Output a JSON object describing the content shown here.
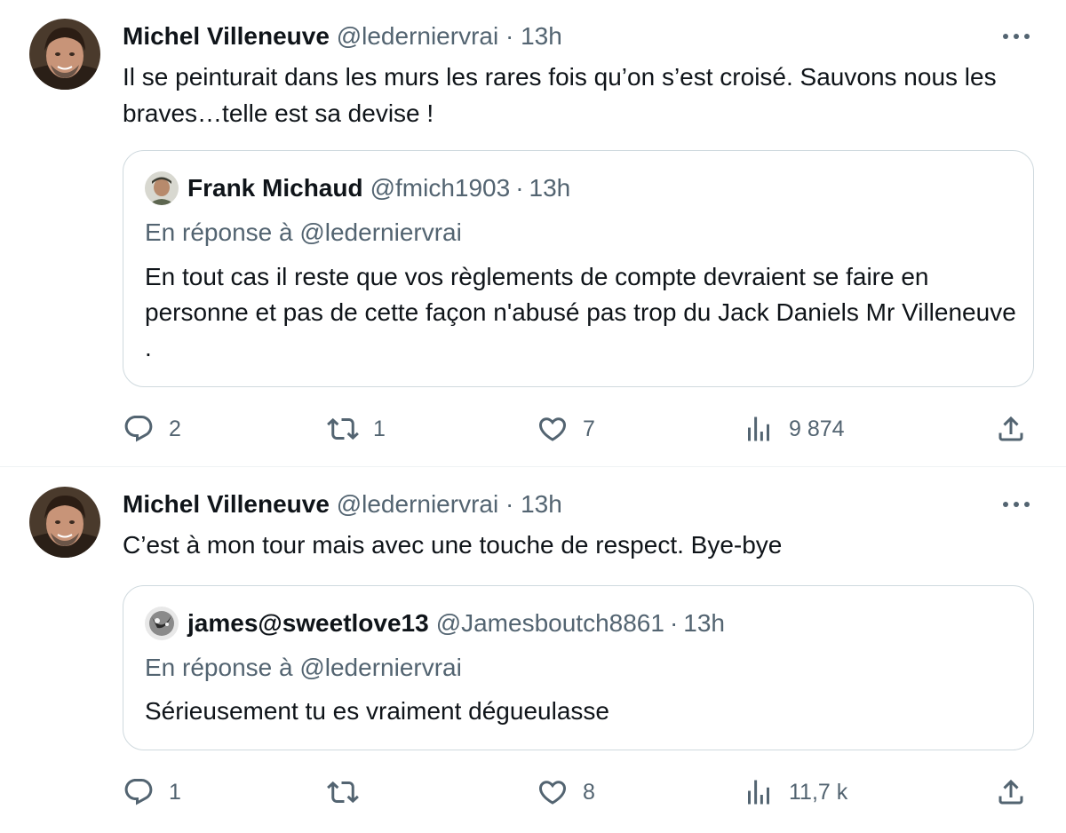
{
  "tweets": [
    {
      "author_name": "Michel Villeneuve",
      "author_handle": "@ledernierv​rai",
      "separator": "·",
      "time": "13h",
      "text": "Il se peinturait dans les murs les rares fois qu’on s’est croisé.  Sauvons nous les braves…telle est sa devise !",
      "quote": {
        "author_name": "Frank Michaud",
        "author_handle": "@fmich1903",
        "separator": "·",
        "time": "13h",
        "reply_to": "En réponse à @ledernierv​rai",
        "text": "En tout cas il reste que vos règlements de compte devraient se faire en personne et pas de cette façon n'abusé pas trop du Jack Daniels Mr Villeneuve ."
      },
      "actions": {
        "replies": "2",
        "retweets": "1",
        "likes": "7",
        "views": "9 874"
      }
    },
    {
      "author_name": "Michel Villeneuve",
      "author_handle": "@ledernierv​rai",
      "separator": "·",
      "time": "13h",
      "text": "C’est à mon tour mais avec une touche de respect.  Bye-bye",
      "quote": {
        "author_name": "james@sweetlove13",
        "author_handle": "@Jamesboutch8861",
        "separator": "·",
        "time": "13h",
        "reply_to": "En réponse à @ledernierv​rai",
        "text": "Sérieusement tu es vraiment dégueulasse"
      },
      "actions": {
        "replies": "1",
        "retweets": "",
        "likes": "8",
        "views": "11,7 k"
      }
    }
  ],
  "icons": {
    "more": "more-horizontal-icon",
    "reply": "reply-bubble-icon",
    "retweet": "retweet-icon",
    "like": "heart-icon",
    "views": "views-bar-chart-icon",
    "share": "share-upload-icon"
  },
  "colors": {
    "text": "#0f1419",
    "secondary": "#536471",
    "border": "#cfd9de"
  }
}
